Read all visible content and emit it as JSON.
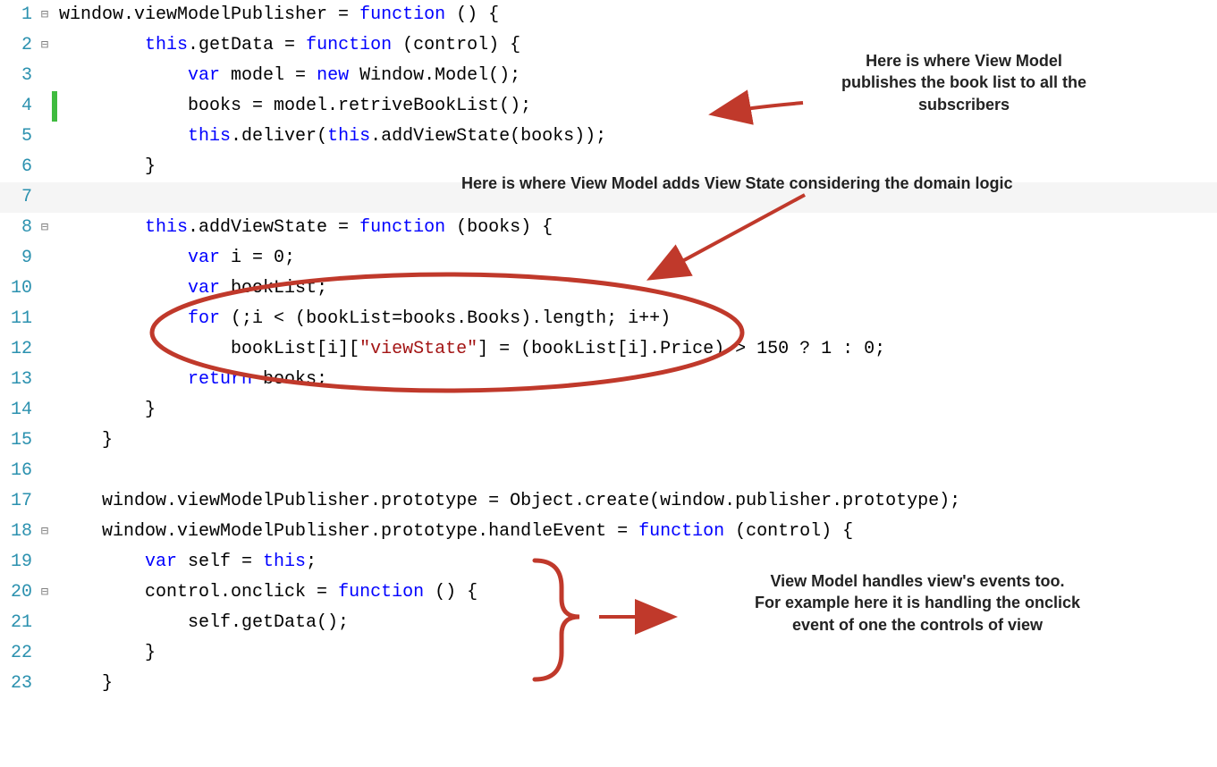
{
  "lines": [
    {
      "n": "1",
      "fold": "⊟",
      "marker": "",
      "tokens": [
        [
          "window.viewModelPublisher = ",
          ""
        ],
        [
          "function",
          "kw"
        ],
        [
          " () {",
          ""
        ]
      ]
    },
    {
      "n": "2",
      "fold": "⊟",
      "marker": "",
      "tokens": [
        [
          "        ",
          ""
        ],
        [
          "this",
          "kw"
        ],
        [
          ".getData = ",
          ""
        ],
        [
          "function",
          "kw"
        ],
        [
          " (control) {",
          ""
        ]
      ]
    },
    {
      "n": "3",
      "fold": "",
      "marker": "",
      "tokens": [
        [
          "            ",
          ""
        ],
        [
          "var",
          "kw"
        ],
        [
          " model = ",
          ""
        ],
        [
          "new",
          "kw"
        ],
        [
          " Window.Model();",
          ""
        ]
      ]
    },
    {
      "n": "4",
      "fold": "",
      "marker": "green",
      "tokens": [
        [
          "            books = model.retriveBookList();",
          ""
        ]
      ]
    },
    {
      "n": "5",
      "fold": "",
      "marker": "",
      "tokens": [
        [
          "            ",
          ""
        ],
        [
          "this",
          "kw"
        ],
        [
          ".deliver(",
          ""
        ],
        [
          "this",
          "kw"
        ],
        [
          ".addViewState(books));",
          ""
        ]
      ]
    },
    {
      "n": "6",
      "fold": "",
      "marker": "",
      "tokens": [
        [
          "        }",
          ""
        ]
      ]
    },
    {
      "n": "7",
      "fold": "",
      "marker": "",
      "tokens": [
        [
          "",
          ""
        ]
      ],
      "sel": true
    },
    {
      "n": "8",
      "fold": "⊟",
      "marker": "",
      "tokens": [
        [
          "        ",
          ""
        ],
        [
          "this",
          "kw"
        ],
        [
          ".addViewState = ",
          ""
        ],
        [
          "function",
          "kw"
        ],
        [
          " (books) {",
          ""
        ]
      ]
    },
    {
      "n": "9",
      "fold": "",
      "marker": "",
      "tokens": [
        [
          "            ",
          ""
        ],
        [
          "var",
          "kw"
        ],
        [
          " i = 0;",
          ""
        ]
      ]
    },
    {
      "n": "10",
      "fold": "",
      "marker": "",
      "tokens": [
        [
          "            ",
          ""
        ],
        [
          "var",
          "kw"
        ],
        [
          " bookList;",
          ""
        ]
      ]
    },
    {
      "n": "11",
      "fold": "",
      "marker": "",
      "tokens": [
        [
          "            ",
          ""
        ],
        [
          "for",
          "kw"
        ],
        [
          " (;i < (bookList=books.Books).length; i++)",
          ""
        ]
      ]
    },
    {
      "n": "12",
      "fold": "",
      "marker": "",
      "tokens": [
        [
          "                bookList[i][",
          ""
        ],
        [
          "\"viewState\"",
          "str"
        ],
        [
          "] = (bookList[i].Price) > 150 ? 1 : 0;",
          ""
        ]
      ]
    },
    {
      "n": "13",
      "fold": "",
      "marker": "",
      "tokens": [
        [
          "            ",
          ""
        ],
        [
          "return",
          "kw"
        ],
        [
          " books;",
          ""
        ]
      ]
    },
    {
      "n": "14",
      "fold": "",
      "marker": "",
      "tokens": [
        [
          "        }",
          ""
        ]
      ]
    },
    {
      "n": "15",
      "fold": "",
      "marker": "",
      "tokens": [
        [
          "    }",
          ""
        ]
      ]
    },
    {
      "n": "16",
      "fold": "",
      "marker": "",
      "tokens": [
        [
          "",
          ""
        ]
      ]
    },
    {
      "n": "17",
      "fold": "",
      "marker": "",
      "tokens": [
        [
          "    window.viewModelPublisher.prototype = Object.create(window.publisher.prototype);",
          ""
        ]
      ]
    },
    {
      "n": "18",
      "fold": "⊟",
      "marker": "",
      "tokens": [
        [
          "    window.viewModelPublisher.prototype.handleEvent = ",
          ""
        ],
        [
          "function",
          "kw"
        ],
        [
          " (control) {",
          ""
        ]
      ]
    },
    {
      "n": "19",
      "fold": "",
      "marker": "",
      "tokens": [
        [
          "        ",
          ""
        ],
        [
          "var",
          "kw"
        ],
        [
          " self = ",
          ""
        ],
        [
          "this",
          "kw"
        ],
        [
          ";",
          ""
        ]
      ]
    },
    {
      "n": "20",
      "fold": "⊟",
      "marker": "",
      "tokens": [
        [
          "        control.onclick = ",
          ""
        ],
        [
          "function",
          "kw"
        ],
        [
          " () {",
          ""
        ]
      ]
    },
    {
      "n": "21",
      "fold": "",
      "marker": "",
      "tokens": [
        [
          "            self.getData();",
          ""
        ]
      ]
    },
    {
      "n": "22",
      "fold": "",
      "marker": "",
      "tokens": [
        [
          "        }",
          ""
        ]
      ]
    },
    {
      "n": "23",
      "fold": "",
      "marker": "",
      "tokens": [
        [
          "    }",
          ""
        ]
      ]
    }
  ],
  "annotations": {
    "a1_l1": "Here is where View Model",
    "a1_l2": "publishes the book list to all the",
    "a1_l3": "subscribers",
    "a2": "Here is where View Model adds View State considering the domain logic",
    "a3_l1": "View Model handles view's events too.",
    "a3_l2": "For example here it is handling the onclick",
    "a3_l3": "event of one the controls of view"
  },
  "colors": {
    "annotation_stroke": "#c0392b"
  }
}
